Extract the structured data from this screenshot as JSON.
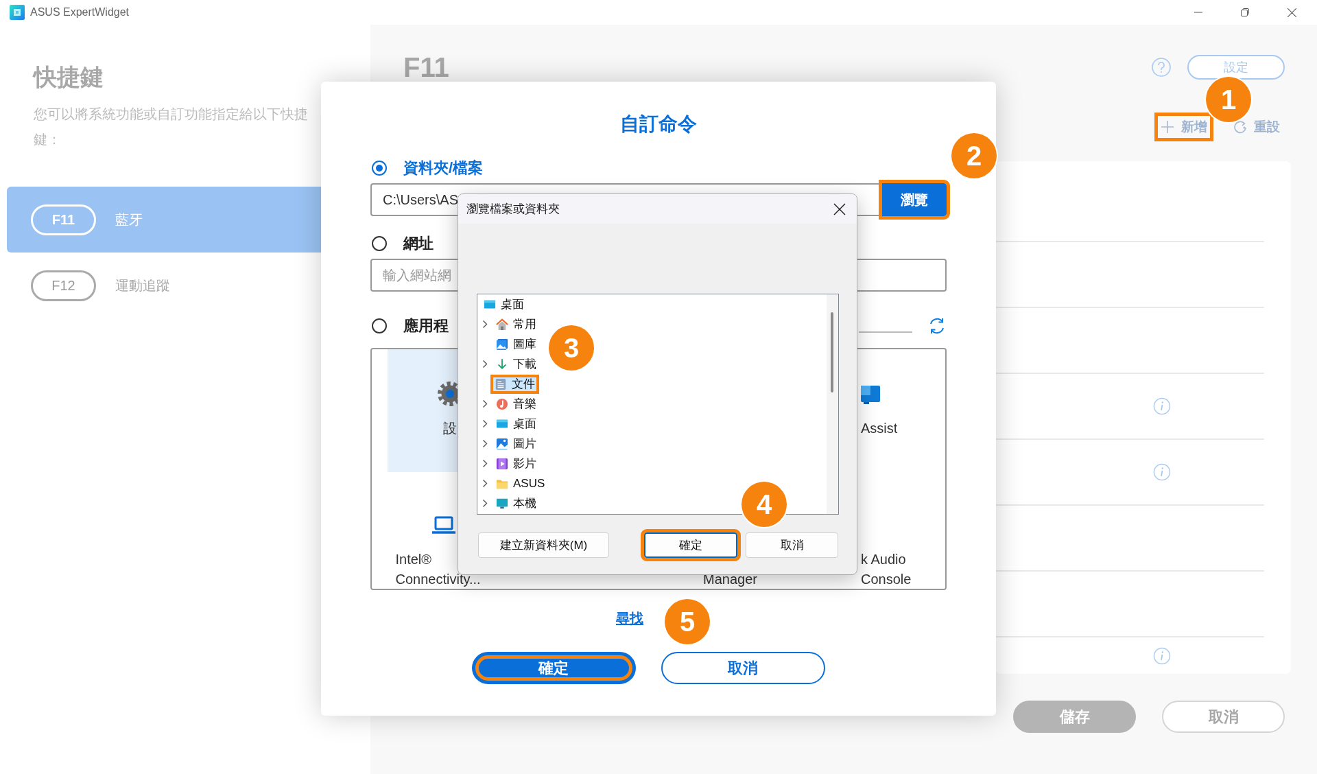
{
  "window": {
    "title": "ASUS ExpertWidget"
  },
  "sidebar": {
    "heading": "快捷鍵",
    "description": "您可以將系統功能或自訂功能指定給以下快捷鍵：",
    "items": [
      {
        "key": "F11",
        "label": "藍牙",
        "selected": true
      },
      {
        "key": "F12",
        "label": "運動追蹤",
        "selected": false
      }
    ]
  },
  "main": {
    "heading": "F11",
    "settings_button": "設定",
    "add_button": {
      "label": "新增",
      "highlighted": true
    },
    "reset_button": {
      "label": "重設",
      "highlighted": false
    },
    "rows": [
      {
        "info": false
      },
      {
        "info": false
      },
      {
        "info": false
      },
      {
        "info": true
      },
      {
        "info": true
      },
      {
        "info": false
      },
      {
        "info": false
      },
      {
        "info": true
      }
    ],
    "save_button": {
      "label": "儲存",
      "disabled": true
    },
    "cancel_button": {
      "label": "取消",
      "disabled": true
    }
  },
  "custom_command_dialog": {
    "title": "自訂命令",
    "options": [
      {
        "kind": "path",
        "label": "資料夾/檔案",
        "selected": true,
        "value": "C:\\Users\\AS",
        "button": {
          "label": "瀏覽",
          "highlighted": true
        }
      },
      {
        "kind": "url",
        "label": "網址",
        "selected": false,
        "placeholder": "輸入網站網"
      },
      {
        "kind": "apps",
        "label": "應用程",
        "selected": false,
        "apps": [
          {
            "kind": "gear",
            "label": "設",
            "selected": true
          },
          {
            "kind": "assist",
            "label": "Assist",
            "selected": false
          },
          {
            "kind": "laptop",
            "label": "Intel® Connectivity...",
            "selected": false
          },
          {
            "kind": "text_only",
            "label": "Manager",
            "selected": false
          },
          {
            "kind": "text_only",
            "label": "k Audio Console",
            "selected": false
          }
        ]
      }
    ],
    "link": "尋找",
    "ok_button": {
      "label": "確定",
      "highlighted": true
    },
    "cancel_button": {
      "label": "取消",
      "highlighted": false
    }
  },
  "browse_dialog": {
    "title": "瀏覽檔案或資料夾",
    "tree": [
      {
        "label": "桌面",
        "kind": "desktop",
        "expandable": false,
        "selected": false,
        "highlighted": false,
        "children": [
          {
            "label": "常用",
            "kind": "home",
            "expandable": true,
            "selected": false,
            "highlighted": false
          },
          {
            "label": "圖庫",
            "kind": "gallery",
            "expandable": false,
            "selected": false,
            "highlighted": false
          },
          {
            "label": "下載",
            "kind": "download",
            "expandable": true,
            "selected": false,
            "highlighted": false
          },
          {
            "label": "文件",
            "kind": "document",
            "expandable": false,
            "selected": true,
            "highlighted": true
          },
          {
            "label": "音樂",
            "kind": "music",
            "expandable": true,
            "selected": false,
            "highlighted": false
          },
          {
            "label": "桌面",
            "kind": "desktop",
            "expandable": true,
            "selected": false,
            "highlighted": false
          },
          {
            "label": "圖片",
            "kind": "pictures",
            "expandable": true,
            "selected": false,
            "highlighted": false
          },
          {
            "label": "影片",
            "kind": "video",
            "expandable": true,
            "selected": false,
            "highlighted": false
          },
          {
            "label": "ASUS",
            "kind": "folder",
            "expandable": true,
            "selected": false,
            "highlighted": false
          },
          {
            "label": "本機",
            "kind": "pc",
            "expandable": true,
            "selected": false,
            "highlighted": false
          }
        ]
      }
    ],
    "new_folder_button": "建立新資料夾(M)",
    "ok_button": {
      "label": "確定",
      "highlighted": true
    },
    "cancel_button": {
      "label": "取消",
      "highlighted": false
    }
  },
  "callouts": [
    "1",
    "2",
    "3",
    "4",
    "5"
  ]
}
